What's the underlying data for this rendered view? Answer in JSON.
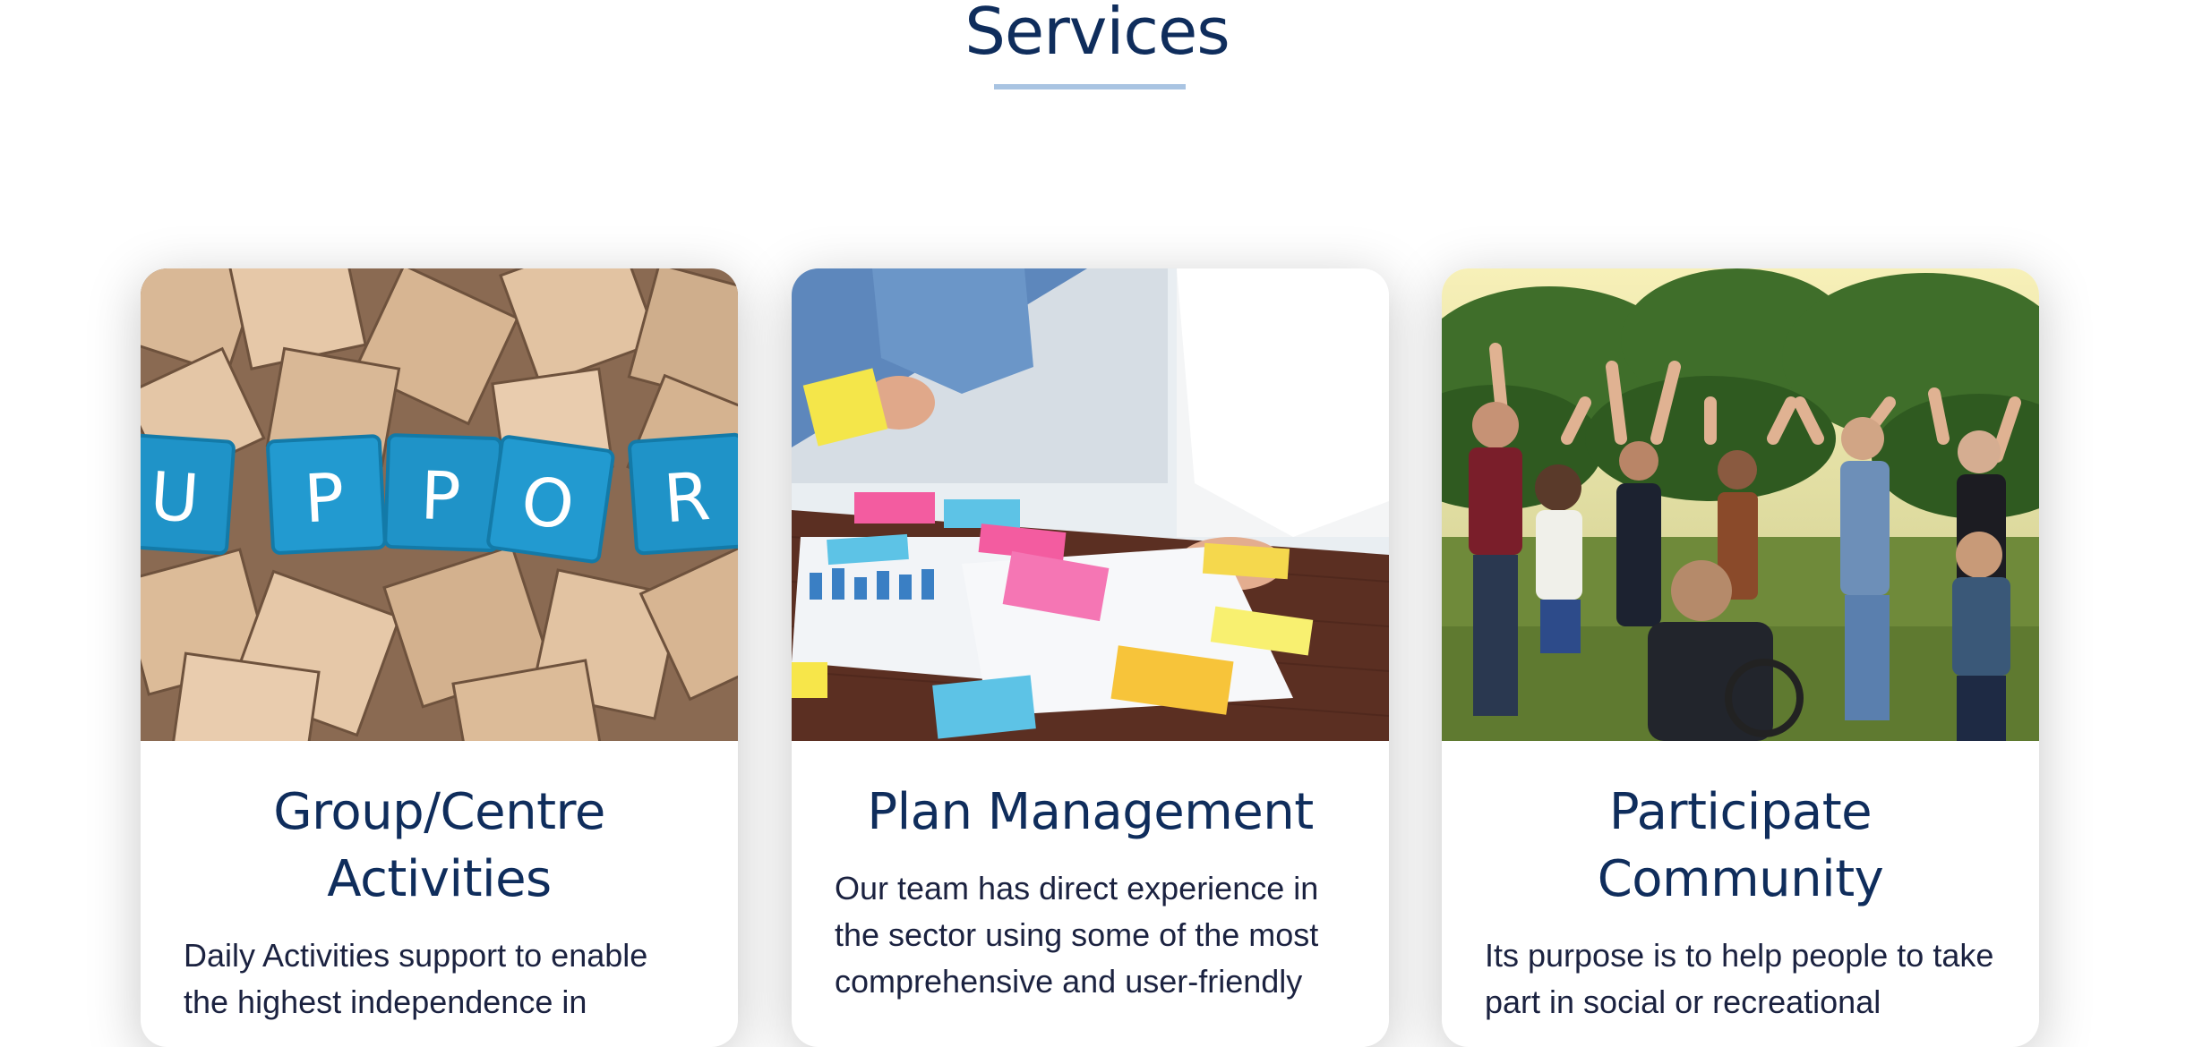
{
  "section": {
    "title": "Services"
  },
  "cards": [
    {
      "title": "Group/Centre Activities",
      "description": "Daily Activities support to enable the highest independence in",
      "image": "scrabble-tiles-support-image"
    },
    {
      "title": "Plan Management",
      "description": "Our team has direct experience in the sector using some of the most comprehensive and user-friendly",
      "image": "team-planning-sticky-notes-image"
    },
    {
      "title": "Participate Community",
      "description": "Its purpose is to help people to take part in social or recreational",
      "image": "community-circle-hands-raised-image"
    }
  ],
  "colors": {
    "heading": "#0f2d5c",
    "underline": "#a9c4e2",
    "body_text": "#1b2240"
  }
}
